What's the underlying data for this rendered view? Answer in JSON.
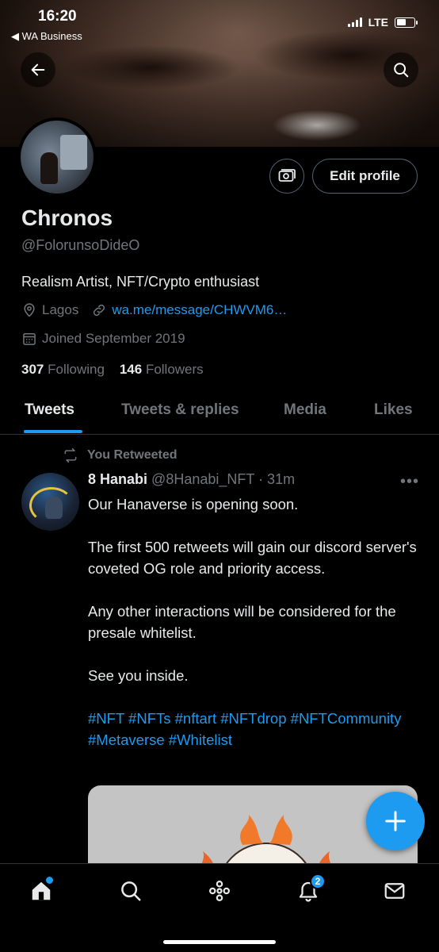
{
  "status_bar": {
    "time": "16:20",
    "back_app": "◀ WA Business",
    "network": "LTE"
  },
  "profile": {
    "name": "Chronos",
    "handle": "@FolorunsoDideO",
    "bio": "Realism Artist, NFT/Crypto enthusiast",
    "location": "Lagos",
    "link": "wa.me/message/CHWVM6…",
    "joined": "Joined September 2019",
    "following_count": "307",
    "following_label": "Following",
    "followers_count": "146",
    "followers_label": "Followers",
    "edit_button": "Edit profile"
  },
  "tabs": [
    "Tweets",
    "Tweets & replies",
    "Media",
    "Likes"
  ],
  "tweet": {
    "retweet_label": "You Retweeted",
    "author_name": "8 Hanabi",
    "author_handle": "@8Hanabi_NFT",
    "time": "· 31m",
    "paragraphs": [
      "Our Hanaverse is opening soon.",
      "The first 500 retweets will gain our discord server's coveted OG role and priority access.",
      "Any other interactions will be considered for the presale whitelist.",
      "See you inside."
    ],
    "hashtags": "#NFT #NFTs #nftart #NFTdrop #NFTCommunity #Metaverse #Whitelist"
  },
  "nav": {
    "notifications_badge": "2"
  },
  "colors": {
    "accent": "#1d9bf0",
    "background": "#000000",
    "muted": "#71767b",
    "text": "#e7e9ea"
  }
}
